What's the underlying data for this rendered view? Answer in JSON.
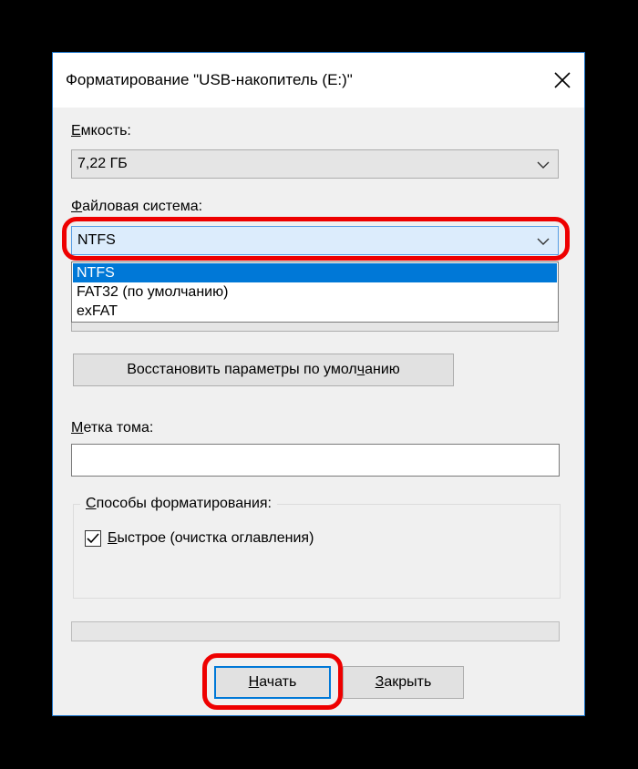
{
  "dialog": {
    "title": "Форматирование \"USB-накопитель (E:)\"",
    "close_icon": "close-icon"
  },
  "capacity": {
    "label_accel": "Е",
    "label_rest": "мкость:",
    "value": "7,22 ГБ"
  },
  "filesystem": {
    "label_accel": "Ф",
    "label_rest": "айловая система:",
    "value": "NTFS",
    "options": [
      "NTFS",
      "FAT32 (по умолчанию)",
      "exFAT"
    ],
    "selected_index": 0
  },
  "restore_button": {
    "label_before": "Восстановить параметры по умол",
    "label_accel": "ч",
    "label_after": "анию"
  },
  "volume_label": {
    "label_accel": "М",
    "label_rest": "етка тома:",
    "value": ""
  },
  "format_options": {
    "group_accel": "С",
    "group_rest": "пособы форматирования:",
    "quick_accel": "Б",
    "quick_rest": "ыстрое (очистка оглавления)",
    "quick_checked": true
  },
  "progress": {
    "value": 0
  },
  "buttons": {
    "start_accel": "Н",
    "start_rest": "ачать",
    "close_accel": "З",
    "close_rest": "акрыть"
  },
  "colors": {
    "highlight": "#e00000",
    "selection": "#0078d7",
    "dialog_bg": "#f0f0f0"
  }
}
